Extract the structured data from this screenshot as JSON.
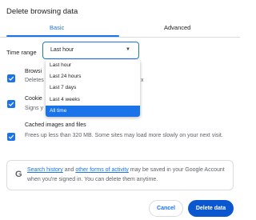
{
  "dialog": {
    "title": "Delete browsing data"
  },
  "tabs": [
    {
      "label": "Basic"
    },
    {
      "label": "Advanced"
    }
  ],
  "time_range": {
    "label": "Time range",
    "value": "Last hour",
    "options": [
      "Last hour",
      "Last 24 hours",
      "Last 7 days",
      "Last 4 weeks",
      "All time"
    ],
    "highlighted": "All time"
  },
  "options": [
    {
      "title": "Browsi",
      "desc": "Deletes",
      "desc_tail": "x",
      "checked": true
    },
    {
      "title": "Cookie",
      "desc": "Signs y",
      "checked": true
    },
    {
      "title": "Cached images and files",
      "desc": "Frees up less than 320 MB. Some sites may load more slowly on your next visit.",
      "checked": true
    }
  ],
  "google_notice": {
    "icon": "google-g-icon",
    "link1": "Search history",
    "text1": " and ",
    "link2": "other forms of activity",
    "text2": " may be saved in your Google Account when you're signed in. You can delete them anytime."
  },
  "buttons": {
    "cancel": "Cancel",
    "delete": "Delete data"
  },
  "colors": {
    "accent": "#1a73e8",
    "primary_button": "#0b57d0",
    "border": "#dadce0"
  }
}
